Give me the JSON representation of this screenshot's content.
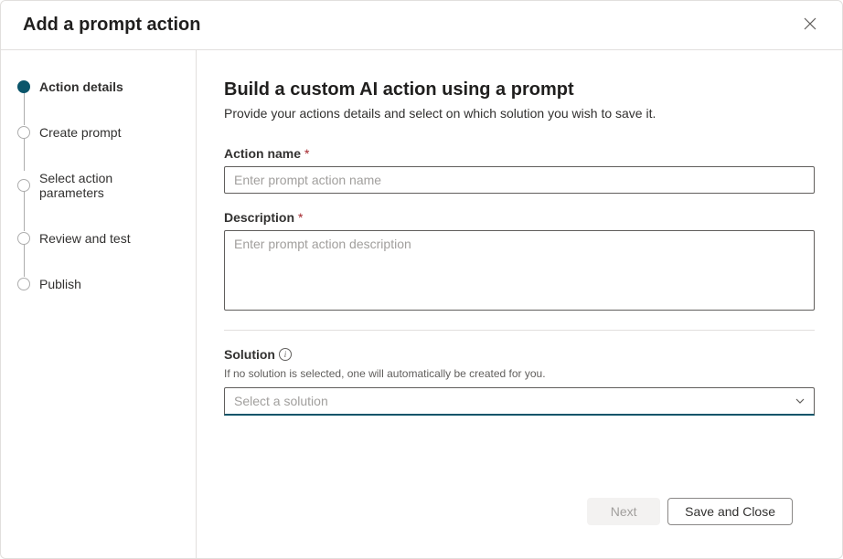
{
  "header": {
    "title": "Add a prompt action"
  },
  "steps": [
    {
      "label": "Action details",
      "active": true
    },
    {
      "label": "Create prompt",
      "active": false
    },
    {
      "label": "Select action parameters",
      "active": false
    },
    {
      "label": "Review and test",
      "active": false
    },
    {
      "label": "Publish",
      "active": false
    }
  ],
  "main": {
    "heading": "Build a custom AI action using a prompt",
    "sub": "Provide your actions details and select on which solution you wish to save it.",
    "action_name_label": "Action name",
    "action_name_placeholder": "Enter prompt action name",
    "action_name_value": "",
    "description_label": "Description",
    "description_placeholder": "Enter prompt action description",
    "description_value": "",
    "solution_label": "Solution",
    "solution_hint": "If no solution is selected, one will automatically be created for you.",
    "solution_placeholder": "Select a solution",
    "solution_value": ""
  },
  "footer": {
    "next_label": "Next",
    "save_close_label": "Save and Close"
  },
  "required_mark": "*"
}
